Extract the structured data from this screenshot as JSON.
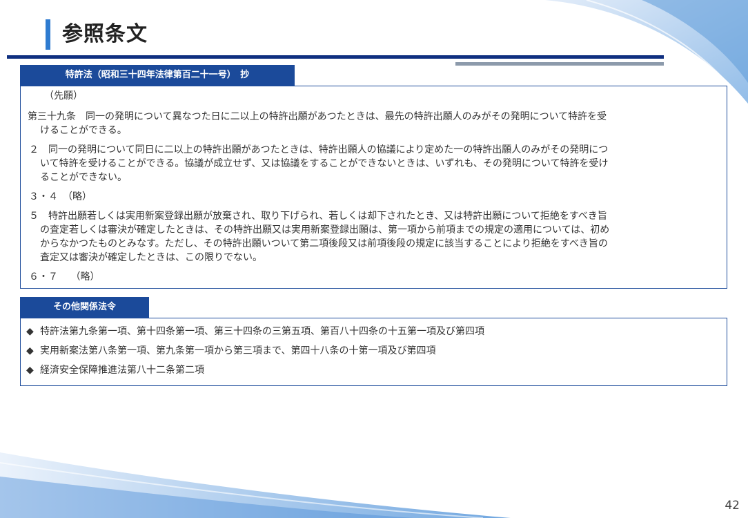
{
  "page": {
    "title": "参照条文",
    "number": "42"
  },
  "section1": {
    "tab_label": "特許法（昭和三十四年法律第百二十一号）　抄",
    "heading": "（先願）",
    "article_prefix": "第三十九条",
    "article_line1": "　同一の発明について異なつた日に二以上の特許出願があつたときは、最先の特許出願人のみがその発明について特許を受",
    "article_line2": "けることができる。",
    "p2_num": "２",
    "p2_line1": "　同一の発明について同日に二以上の特許出願があつたときは、特許出願人の協議により定めた一の特許出願人のみがその発明につ",
    "p2_line2": "いて特許を受けることができる。協議が成立せず、又は協議をすることができないときは、いずれも、その発明について特許を受け",
    "p2_line3": "ることができない。",
    "p34": "３・４　（略）",
    "p5_num": "５",
    "p5_line1": "　特許出願若しくは実用新案登録出願が放棄され、取り下げられ、若しくは却下されたとき、又は特許出願について拒絶をすべき旨",
    "p5_line2": "の査定若しくは審決が確定したときは、その特許出願又は実用新案登録出願は、第一項から前項までの規定の適用については、初め",
    "p5_line3": "からなかつたものとみなす。ただし、その特許出願いついて第二項後段又は前項後段の規定に該当することにより拒絶をすべき旨の",
    "p5_line4": "査定又は審決が確定したときは、この限りでない。",
    "p67": "６・７　 （略）"
  },
  "section2": {
    "tab_label": "その他関係法令",
    "bullet_symbol": "◆",
    "items": [
      "特許法第九条第一項、第十四条第一項、第三十四条の三第五項、第百八十四条の十五第一項及び第四項",
      "実用新案法第八条第一項、第九条第一項から第三項まで、第四十八条の十第一項及び第四項",
      "経済安全保障推進法第八十二条第二項"
    ]
  },
  "colors": {
    "accent_blue": "#2e7bd0",
    "navy": "#1b4a9a",
    "rule_navy": "#0f2f80",
    "rule_gray": "#8c9aab"
  }
}
